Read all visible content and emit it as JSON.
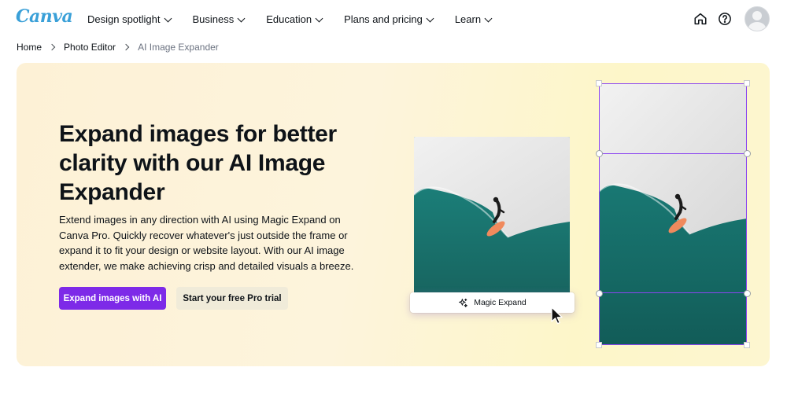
{
  "brand": {
    "logo_text": "Canva",
    "accent": "#7d2ae8",
    "logo_color": "#3aa0d8"
  },
  "nav": {
    "menu": [
      {
        "label": "Design spotlight"
      },
      {
        "label": "Business"
      },
      {
        "label": "Education"
      },
      {
        "label": "Plans and pricing"
      },
      {
        "label": "Learn"
      }
    ],
    "icons": [
      "home-icon",
      "help-icon",
      "avatar"
    ]
  },
  "breadcrumb": {
    "items": [
      {
        "label": "Home"
      },
      {
        "label": "Photo Editor"
      },
      {
        "label": "AI Image Expander"
      }
    ]
  },
  "hero": {
    "title": "Expand images for better clarity with our AI Image Expander",
    "description": "Extend images in any direction with AI using Magic Expand on Canva Pro. Quickly recover whatever's just outside the frame or expand it to fit your design or website layout. With our AI image extender, we make achieving crisp and detailed visuals a breeze.",
    "primary_button": "Expand images with AI",
    "secondary_button": "Start your free Pro trial",
    "background": "#fdf3d8"
  },
  "illustration": {
    "magic_button_label": "Magic Expand",
    "frame_color": "#8b45f0",
    "sea_color": "#1f7d78",
    "foam_color": "#eeeeee"
  }
}
